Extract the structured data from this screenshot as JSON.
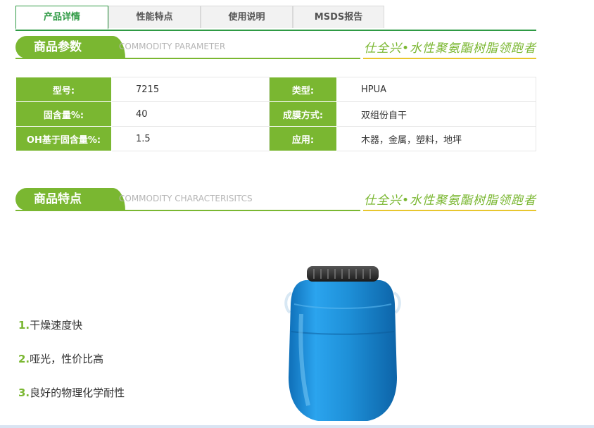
{
  "tabs": [
    {
      "label": "产品详情",
      "active": true
    },
    {
      "label": "性能特点",
      "active": false
    },
    {
      "label": "使用说明",
      "active": false
    },
    {
      "label": "MSDS报告",
      "active": false
    }
  ],
  "section_params": {
    "title": "商品参数",
    "subtitle": "COMMODITY PARAMETER",
    "slogan": "仕全兴•水性聚氨酯树脂领跑者"
  },
  "params": {
    "rows": [
      {
        "k1": "型号:",
        "v1": "7215",
        "k2": "类型:",
        "v2": "HPUA"
      },
      {
        "k1": "固含量%:",
        "v1": "40",
        "k2": "成膜方式:",
        "v2": "双组份自干"
      },
      {
        "k1": "OH基于固含量%:",
        "v1": "1.5",
        "k2": "应用:",
        "v2": "木器，金属，塑料，地坪"
      }
    ]
  },
  "section_features": {
    "title": "商品特点",
    "subtitle": "COMMODITY CHARACTERISITCS",
    "slogan": "仕全兴•水性聚氨酯树脂领跑者"
  },
  "features": [
    {
      "num": "1.",
      "text": "干燥速度快"
    },
    {
      "num": "2.",
      "text": "哑光，性价比高"
    },
    {
      "num": "3.",
      "text": "良好的物理化学耐性"
    }
  ],
  "colors": {
    "brand_green": "#7ab731",
    "tab_green": "#2e9a44",
    "slogan_underline": "#e8c62e",
    "bucket_blue": "#1e90d8"
  }
}
